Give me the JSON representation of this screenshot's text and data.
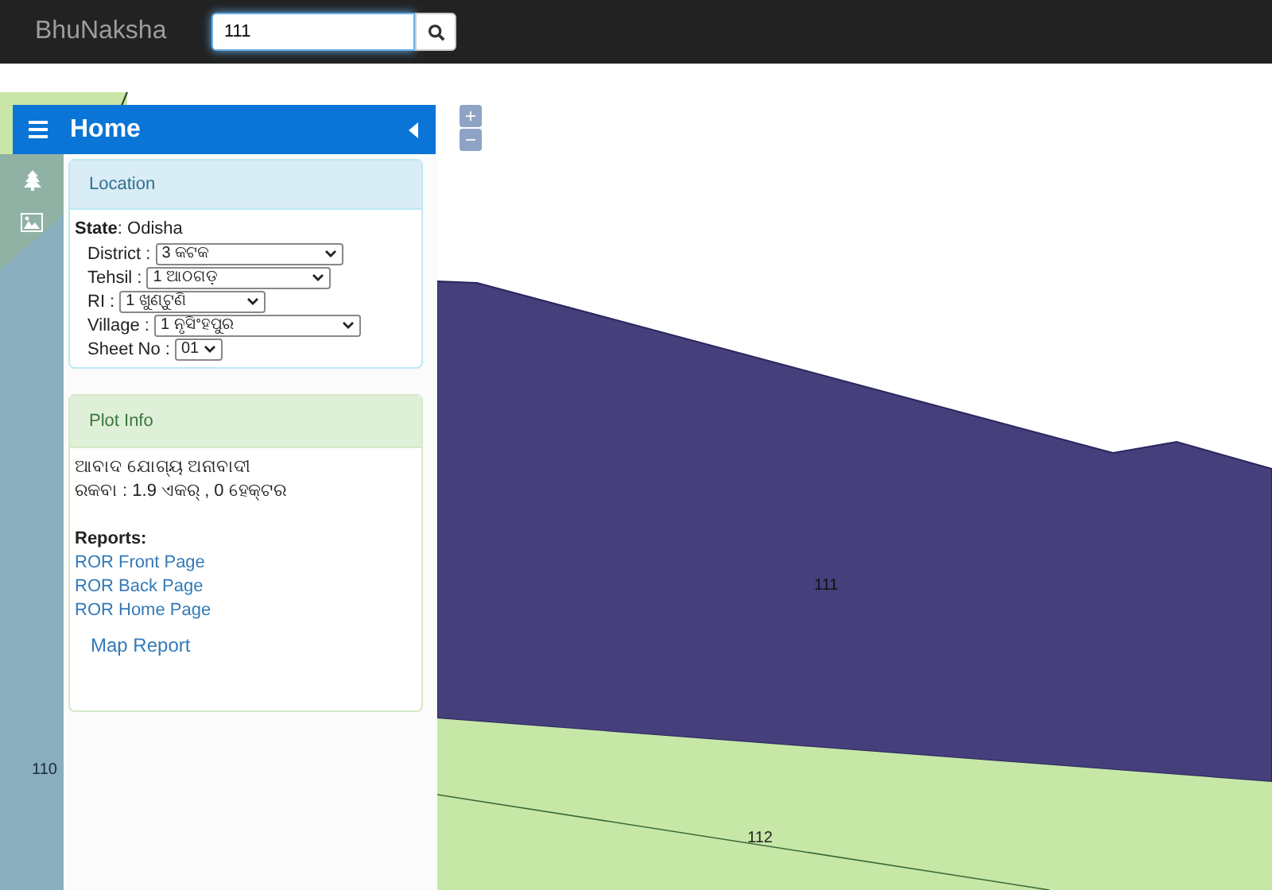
{
  "navbar": {
    "brand": "BhuNaksha",
    "search": {
      "value": "111"
    }
  },
  "map": {
    "zoom_in": "+",
    "zoom_out": "−",
    "parcels": [
      {
        "label": "111"
      },
      {
        "label": "112"
      },
      {
        "label": "110"
      }
    ]
  },
  "sidebar": {
    "title": "Home",
    "location": {
      "title": "Location",
      "state_label": "State",
      "state_value": ": Odisha",
      "fields": [
        {
          "label": "District :",
          "value": "3 କଟକ"
        },
        {
          "label": "Tehsil :",
          "value": "1 ଆଠଗଡ଼"
        },
        {
          "label": "RI :",
          "value": "1 ଖୁଣ୍ଟୁଣି"
        },
        {
          "label": "Village :",
          "value": "1 ନୃସିଂହପୁର"
        },
        {
          "label": "Sheet No  :",
          "value": "01"
        }
      ]
    },
    "plot_info": {
      "title": "Plot Info",
      "lines": [
        "ଆବାଦ ଯୋଗ୍ୟ ଅନାବାଦୀ",
        "ରକବା : 1.9 ଏକର୍ , 0 ହେକ୍ଟର"
      ],
      "reports_label": "Reports:",
      "reports": [
        "ROR Front Page",
        "ROR Back Page",
        "ROR Home Page"
      ],
      "map_report": "Map Report"
    }
  }
}
